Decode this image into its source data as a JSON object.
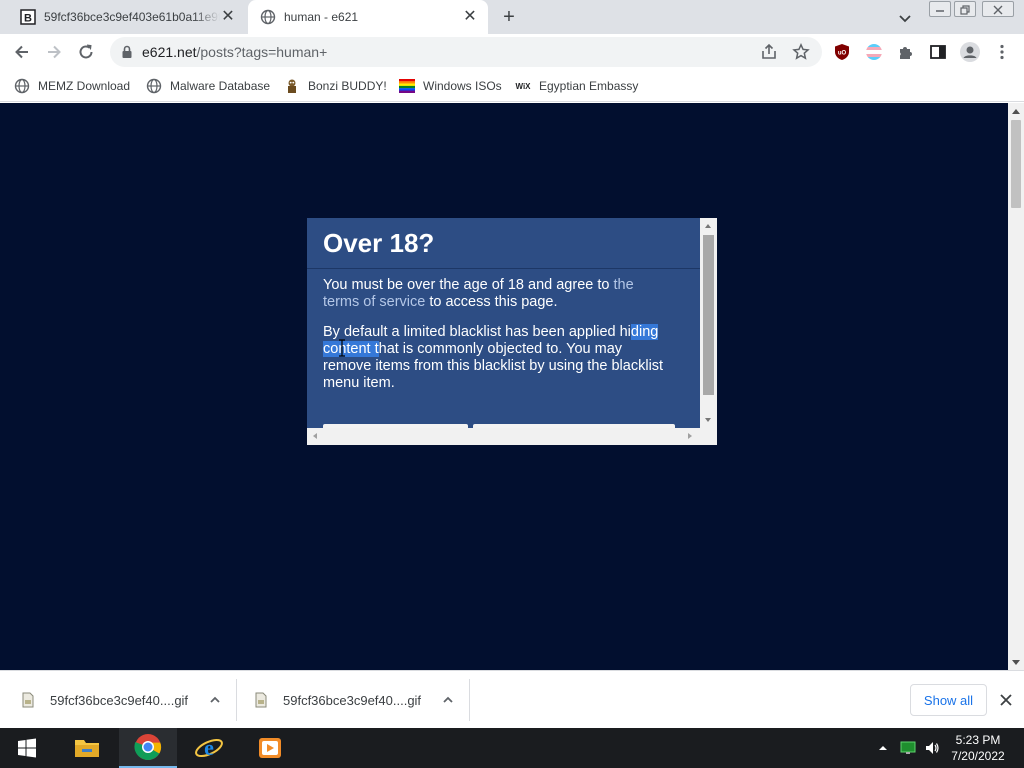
{
  "tabs": [
    {
      "title": "59fcf36bce3c9ef403e61b0a11e9f",
      "favicon": "bonzi-b-icon",
      "active": false
    },
    {
      "title": "human - e621",
      "favicon": "globe-icon",
      "active": true
    }
  ],
  "omnibox": {
    "host": "e621.net",
    "path": "/posts?tags=human+"
  },
  "bookmarks": [
    {
      "label": "MEMZ Download",
      "icon": "globe-icon"
    },
    {
      "label": "Malware Database",
      "icon": "globe-icon"
    },
    {
      "label": "Bonzi BUDDY!",
      "icon": "bonzi-icon"
    },
    {
      "label": "Windows ISOs",
      "icon": "rainbow-flag-icon"
    },
    {
      "label": "Egyptian Embassy",
      "icon": "wix-icon"
    }
  ],
  "dialog": {
    "title": "Over 18?",
    "p1_before": "You must be over the age of 18 and agree to ",
    "p1_link": "the terms of service",
    "p1_after": " to access this page.",
    "p2_a": "By default a limited blacklist has been applied hi",
    "p2_selected": "ding content t",
    "p2_b": "hat is commonly objected to. You may remove items from this blacklist by using the blacklist menu item."
  },
  "downloads": {
    "items": [
      {
        "filename": "59fcf36bce3c9ef40....gif"
      },
      {
        "filename": "59fcf36bce3c9ef40....gif"
      }
    ],
    "show_all": "Show all"
  },
  "taskbar": {
    "time": "5:23 PM",
    "date": "7/20/2022",
    "apps": [
      "file-explorer-icon",
      "chrome-icon",
      "internet-explorer-icon",
      "media-player-icon"
    ]
  },
  "colors": {
    "page_bg": "#020f2f",
    "dialog_bg": "#2d4d84",
    "link": "#b4c7e7",
    "selection": "#3578d8"
  }
}
